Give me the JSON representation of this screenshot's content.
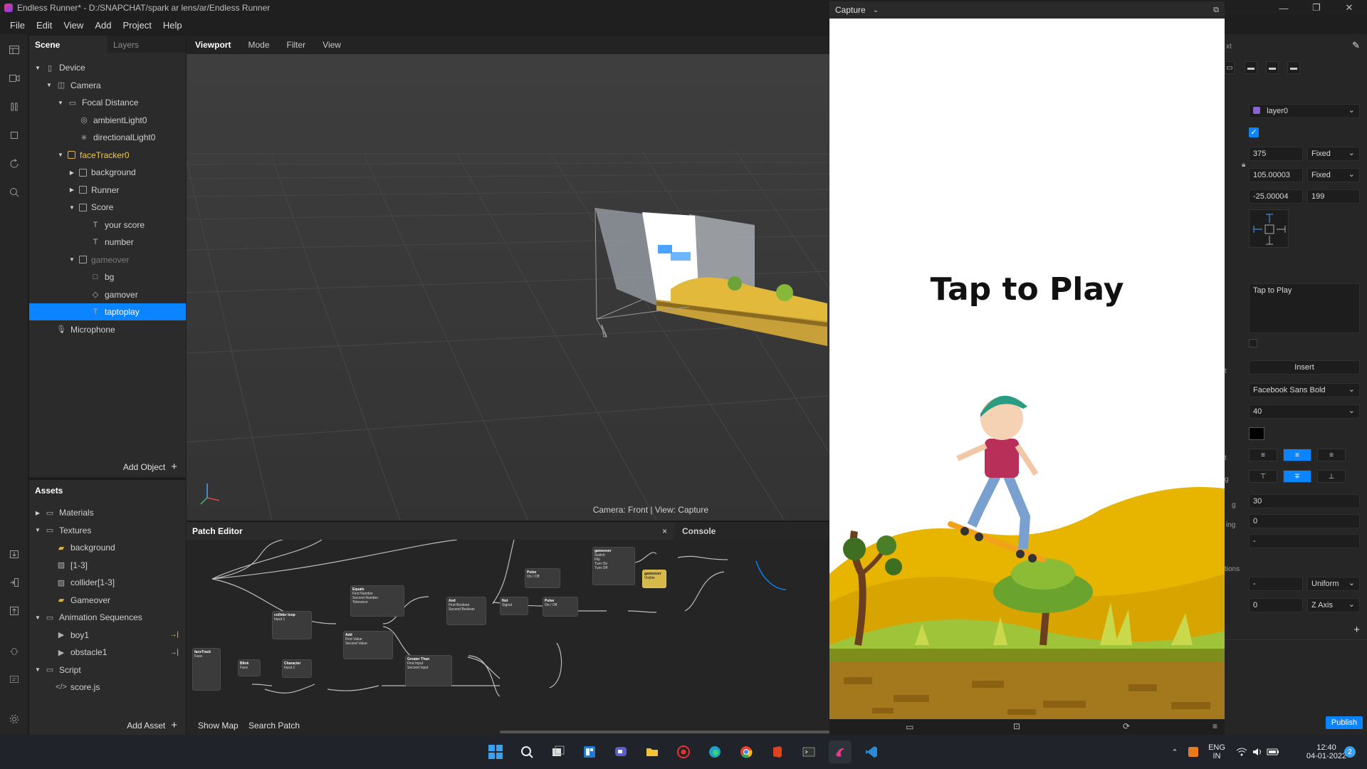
{
  "window": {
    "title": "Endless Runner* - D:/SNAPCHAT/spark ar lens/ar/Endless Runner",
    "controls": [
      "—",
      "❐",
      "✕"
    ]
  },
  "menu": [
    "File",
    "Edit",
    "View",
    "Add",
    "Project",
    "Help"
  ],
  "scene": {
    "tabs": [
      "Scene",
      "Layers"
    ],
    "tree": [
      {
        "label": "Device",
        "depth": 0,
        "caret": "down",
        "icon": "device-icon"
      },
      {
        "label": "Camera",
        "depth": 1,
        "caret": "down",
        "icon": "camera-icon"
      },
      {
        "label": "Focal Distance",
        "depth": 2,
        "caret": "down",
        "icon": "focal-distance-icon"
      },
      {
        "label": "ambientLight0",
        "depth": 3,
        "caret": "",
        "icon": "ambient-light-icon"
      },
      {
        "label": "directionalLight0",
        "depth": 3,
        "caret": "",
        "icon": "directional-light-icon"
      },
      {
        "label": "faceTracker0",
        "depth": 2,
        "caret": "down",
        "icon": "face-tracker-icon",
        "accent": true
      },
      {
        "label": "background",
        "depth": 3,
        "caret": "right",
        "icon": "plane-icon"
      },
      {
        "label": "Runner",
        "depth": 3,
        "caret": "right",
        "icon": "plane-icon"
      },
      {
        "label": "Score",
        "depth": 3,
        "caret": "down",
        "icon": "plane-icon"
      },
      {
        "label": "your score",
        "depth": 4,
        "caret": "",
        "icon": "text-icon"
      },
      {
        "label": "number",
        "depth": 4,
        "caret": "",
        "icon": "text-icon"
      },
      {
        "label": "gameover",
        "depth": 3,
        "caret": "down",
        "icon": "plane-icon",
        "dim": true
      },
      {
        "label": "bg",
        "depth": 4,
        "caret": "",
        "icon": "rectangle-icon"
      },
      {
        "label": "gamover",
        "depth": 4,
        "caret": "",
        "icon": "material-icon"
      },
      {
        "label": "taptoplay",
        "depth": 4,
        "caret": "",
        "icon": "text-icon",
        "selected": true
      },
      {
        "label": "Microphone",
        "depth": 1,
        "caret": "",
        "icon": "microphone-icon"
      }
    ],
    "add_object": "Add Object"
  },
  "assets": {
    "title": "Assets",
    "tree": [
      {
        "label": "Materials",
        "depth": 0,
        "caret": "right",
        "icon": "folder-icon"
      },
      {
        "label": "Textures",
        "depth": 0,
        "caret": "down",
        "icon": "folder-icon"
      },
      {
        "label": "background",
        "depth": 1,
        "caret": "",
        "icon": "texture-thumb-icon"
      },
      {
        "label": "[1-3]",
        "depth": 1,
        "caret": "",
        "icon": "image-icon"
      },
      {
        "label": "collider[1-3]",
        "depth": 1,
        "caret": "",
        "icon": "image-icon"
      },
      {
        "label": "Gameover",
        "depth": 1,
        "caret": "",
        "icon": "texture-thumb-icon"
      },
      {
        "label": "Animation Sequences",
        "depth": 0,
        "caret": "down",
        "icon": "folder-icon"
      },
      {
        "label": "boy1",
        "depth": 1,
        "caret": "",
        "icon": "sequence-icon",
        "link": true
      },
      {
        "label": "obstacle1",
        "depth": 1,
        "caret": "",
        "icon": "sequence-icon",
        "link": true
      },
      {
        "label": "Script",
        "depth": 0,
        "caret": "down",
        "icon": "folder-icon"
      },
      {
        "label": "score.js",
        "depth": 1,
        "caret": "",
        "icon": "script-icon"
      }
    ],
    "add_asset": "Add Asset"
  },
  "viewport": {
    "tabs": [
      "Viewport",
      "Mode",
      "Filter",
      "View"
    ],
    "status": "Camera: Front | View: Capture"
  },
  "patch_editor": {
    "title": "Patch Editor",
    "close": "×",
    "console_tab": "Console",
    "show_map": "Show Map",
    "search_patch": "Search Patch",
    "nodes": [
      {
        "title": "Equals",
        "ports": [
          "First Number",
          "Second Number",
          "Tolerance"
        ]
      },
      {
        "title": "collider loop",
        "ports": [
          "Input 1"
        ]
      },
      {
        "title": "Add",
        "ports": [
          "First Value",
          "Second Value"
        ]
      },
      {
        "title": "And",
        "ports": [
          "First Boolean",
          "Second Boolean"
        ]
      },
      {
        "title": "Not",
        "ports": [
          "Signal"
        ]
      },
      {
        "title": "Pulse",
        "ports": [
          "On / Off"
        ]
      },
      {
        "title": "Pulse",
        "ports": [
          "On / Off"
        ]
      },
      {
        "title": "gameover",
        "ports": [
          "Switch",
          "Flip",
          "Turn On",
          "Turn Off"
        ]
      },
      {
        "title": "gameover",
        "ports": [
          "Visible"
        ]
      },
      {
        "title": "faceTrack",
        "ports": [
          "Face"
        ]
      },
      {
        "title": "Blink",
        "ports": [
          "Face"
        ]
      },
      {
        "title": "Character",
        "ports": [
          "Input 1"
        ]
      },
      {
        "title": "Greater Than",
        "ports": [
          "First Input",
          "Second Input"
        ]
      }
    ]
  },
  "capture": {
    "title": "Capture",
    "headline": "Tap to Play"
  },
  "inspector": {
    "header_fragment": "xt",
    "layer": "layer0",
    "width": "375",
    "width_mode": "Fixed",
    "height": "105.00003",
    "height_mode": "Fixed",
    "pos_x": "-25.00004",
    "pos_y": "199",
    "text": "Tap to Play",
    "insert": "Insert",
    "font": "Facebook Sans Bold",
    "size": "40",
    "spacing_1": "30",
    "spacing_2": "0",
    "spacing_3": "-",
    "scale": "-",
    "scale_mode": "Uniform",
    "rotation": "0",
    "rotation_axis": "Z Axis",
    "label_fragments": [
      "xt",
      "t",
      "t",
      "g",
      "ing",
      "tions"
    ],
    "publish": "Publish"
  },
  "taskbar": {
    "lang_1": "ENG",
    "lang_2": "IN",
    "time": "12:40",
    "date": "04-01-2022",
    "notifications": "2"
  },
  "colors": {
    "accent": "#0b84ff",
    "selection": "#0b84ff",
    "face_tracker": "#e3b341",
    "panel": "#2b2b2b",
    "viewport": "#3a3a3a"
  }
}
